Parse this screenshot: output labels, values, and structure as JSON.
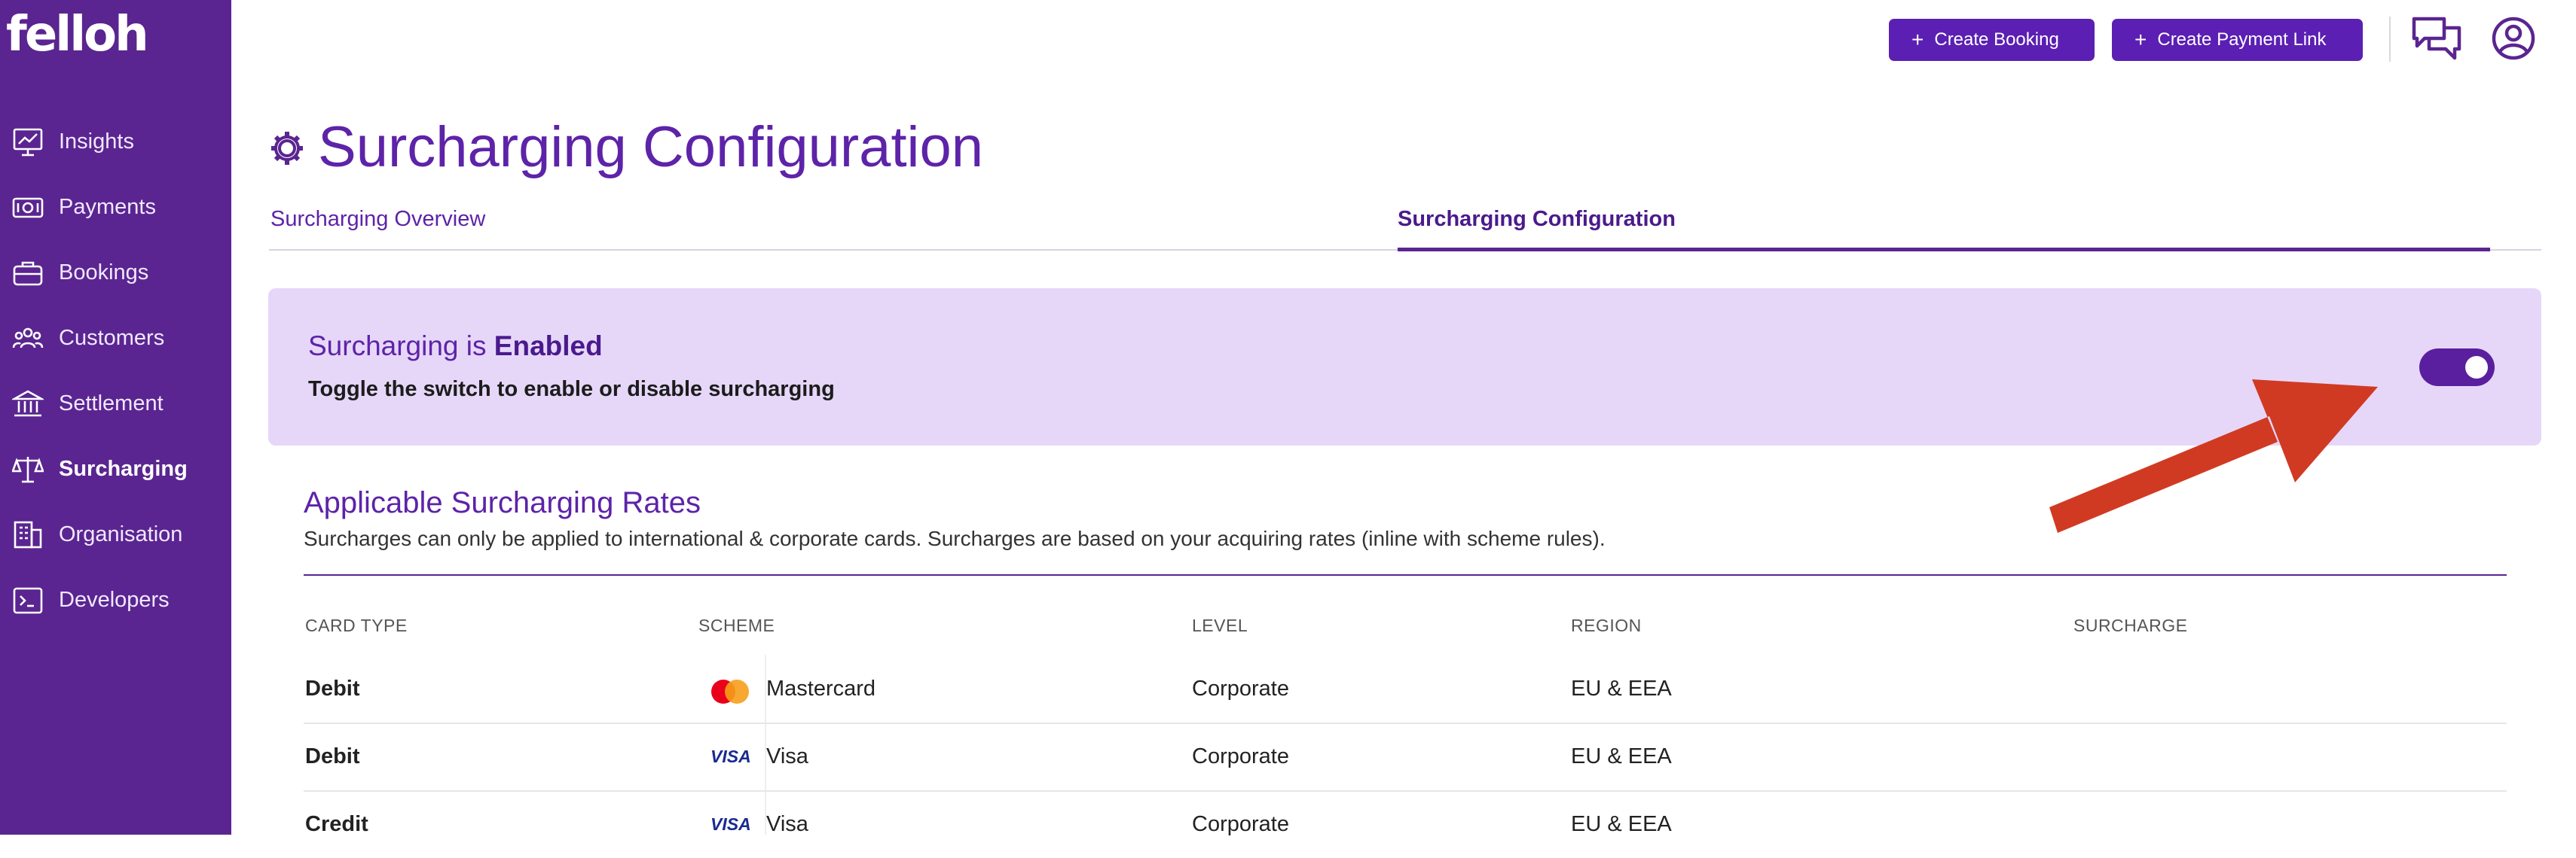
{
  "sidebar": {
    "logo": "felloh",
    "items": [
      {
        "label": "Insights",
        "icon": "chart-icon"
      },
      {
        "label": "Payments",
        "icon": "payments-icon"
      },
      {
        "label": "Bookings",
        "icon": "briefcase-icon"
      },
      {
        "label": "Customers",
        "icon": "customers-icon"
      },
      {
        "label": "Settlement",
        "icon": "bank-icon"
      },
      {
        "label": "Surcharging",
        "icon": "scales-icon",
        "active": true
      },
      {
        "label": "Organisation",
        "icon": "building-icon"
      },
      {
        "label": "Developers",
        "icon": "terminal-icon"
      }
    ]
  },
  "header": {
    "create_booking": "Create Booking",
    "create_payment_link": "Create Payment Link"
  },
  "page": {
    "title": "Surcharging Configuration",
    "tabs": [
      {
        "label": "Surcharging Overview",
        "active": false
      },
      {
        "label": "Surcharging Configuration",
        "active": true
      }
    ]
  },
  "banner": {
    "title_prefix": "Surcharging is",
    "status": "Enabled",
    "subtitle": "Toggle the switch to enable or disable surcharging",
    "toggle_on": true
  },
  "rates": {
    "title": "Applicable Surcharging Rates",
    "description": "Surcharges can only be applied to international & corporate cards. Surcharges are based on your acquiring rates (inline with scheme rules).",
    "columns": [
      "CARD TYPE",
      "SCHEME",
      "LEVEL",
      "REGION",
      "SURCHARGE"
    ],
    "rows": [
      {
        "card_type": "Debit",
        "scheme": "Mastercard",
        "scheme_logo": "mastercard",
        "level": "Corporate",
        "region": "EU & EEA",
        "surcharge": ""
      },
      {
        "card_type": "Debit",
        "scheme": "Visa",
        "scheme_logo": "visa",
        "level": "Corporate",
        "region": "EU & EEA",
        "surcharge": ""
      },
      {
        "card_type": "Credit",
        "scheme": "Visa",
        "scheme_logo": "visa",
        "level": "Corporate",
        "region": "EU & EEA",
        "surcharge": ""
      }
    ],
    "visa_logo_text": "VISA"
  },
  "colors": {
    "sidebar": "#5a2590",
    "accent": "#5b1fb3",
    "banner": "#e6d7f9",
    "annotation_arrow": "#d13a22"
  }
}
